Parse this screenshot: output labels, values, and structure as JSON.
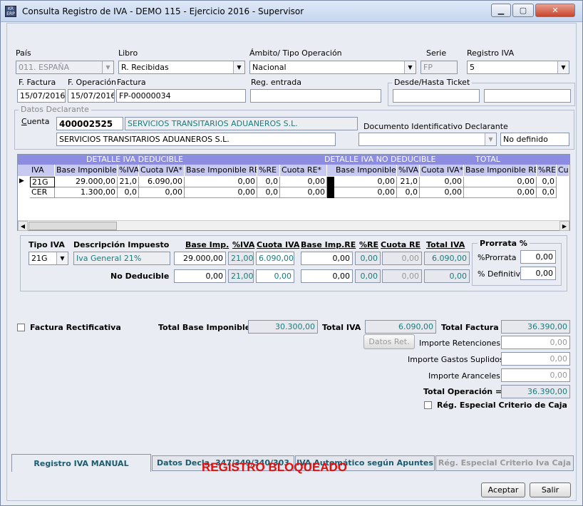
{
  "window": {
    "title": "Consulta Registro de IVA - DEMO 115 - Ejercicio 2016 - Supervisor",
    "app_icon_text": "KR ERP"
  },
  "header": {
    "pais_label": "País",
    "pais_value": "011. ESPAÑA",
    "libro_label": "Libro",
    "libro_value": "R. Recibidas",
    "ambito_label": "Ámbito/ Tipo Operación",
    "ambito_value": "Nacional",
    "serie_label": "Serie",
    "serie_value": "FP",
    "registro_label": "Registro IVA",
    "registro_value": "5",
    "ffactura_label": "F. Factura",
    "ffactura_value": "15/07/2016",
    "foperacion_label": "F. Operación",
    "foperacion_value": "15/07/2016",
    "factura_label": "Factura",
    "factura_value": "FP-00000034",
    "regentrada_label": "Reg. entrada",
    "regentrada_value": "",
    "ticket_label": "Desde/Hasta Ticket",
    "ticket_from": "",
    "ticket_to": ""
  },
  "declarante": {
    "group_label": "Datos Declarante",
    "cuenta_label": "Cuenta",
    "cuenta_value": "400002525",
    "cuenta_name": "SERVICIOS TRANSITARIOS ADUANEROS S.L.",
    "nombre_value": "SERVICIOS TRANSITARIOS ADUANEROS S.L.",
    "doc_label": "Documento Identificativo Declarante",
    "doc_value": "",
    "doc_text": "No definido"
  },
  "grid": {
    "group_headers": [
      "DETALLE IVA DEDUCIBLE",
      "DETALLE IVA NO DEDUCIBLE",
      "TOTAL"
    ],
    "columns": [
      "IVA",
      "Base Imponible*",
      "%IVA",
      "Cuota IVA*",
      "Base Imponible RE",
      "%RE",
      "Cuota RE*",
      "Base Imponible*",
      "%IVA",
      "Cuota IVA*",
      "Base Imponible RE",
      "%RE",
      "Cu"
    ],
    "rows": [
      [
        "21G",
        "29.000,00",
        "21,0",
        "6.090,00",
        "0,00",
        "0,0",
        "0,00",
        "0,00",
        "21,0",
        "0,00",
        "0,00",
        "0,0"
      ],
      [
        "CER",
        "1.300,00",
        "0,0",
        "0,00",
        "0,00",
        "0,0",
        "0,00",
        "0,00",
        "0,0",
        "0,00",
        "0,00",
        "0,0"
      ]
    ]
  },
  "detail": {
    "tipo_iva_label": "Tipo IVA",
    "tipo_iva_value": "21G",
    "desc_label": "Descripción Impuesto",
    "desc_value": "Iva General 21%",
    "base_label": "Base Imp.",
    "piva_label": "%IVA",
    "cuota_label": "Cuota IVA",
    "basere_label": "Base Imp.RE",
    "pre_label": "%RE",
    "cuotare_label": "Cuota RE",
    "total_label": "Total IVA",
    "row1": {
      "base": "29.000,00",
      "piva": "21,00",
      "cuota": "6.090,00",
      "basere": "0,00",
      "pre": "0,00",
      "cuotare": "0,00",
      "total": "6.090,00"
    },
    "nodeducible_label": "No  Deducible",
    "row2": {
      "base": "0,00",
      "piva": "21,00",
      "cuota": "0,00",
      "basere": "0,00",
      "pre": "0,00",
      "cuotare": "0,00",
      "total": "0,00"
    },
    "prorrata_group": "Prorrata %",
    "prorrata_label": "%Prorrata",
    "prorrata_value": "0,00",
    "definitiva_label": "% Definitiva",
    "definitiva_value": "0,00"
  },
  "totals": {
    "rectificativa_label": "Factura Rectificativa",
    "total_base_label": "Total Base Imponible",
    "total_base_value": "30.300,00",
    "total_iva_label": "Total IVA",
    "total_iva_value": "6.090,00",
    "total_factura_label": "Total Factura",
    "total_factura_value": "36.390,00",
    "datos_ret_label": "Datos Ret.",
    "retenciones_label": "Importe Retenciones +",
    "retenciones_value": "0,00",
    "suplidos_label": "Importe Gastos Suplidos +",
    "suplidos_value": "0,00",
    "aranceles_label": "Importe Aranceles +",
    "aranceles_value": "0,00",
    "operacion_label": "Total Operación =",
    "operacion_value": "36.390,00",
    "criterio_caja_label": "Rég. Especial Criterio de Caja"
  },
  "tabs": [
    "Registro IVA MANUAL",
    "Datos Decla. 347/349/340/303",
    "IVA Automático según Apuntes",
    "Rég. Especial Criterio Iva Caja"
  ],
  "footer": {
    "locked_text": "REGISTRO BLOQUEADO",
    "accept_label": "Aceptar",
    "exit_label": "Salir"
  }
}
